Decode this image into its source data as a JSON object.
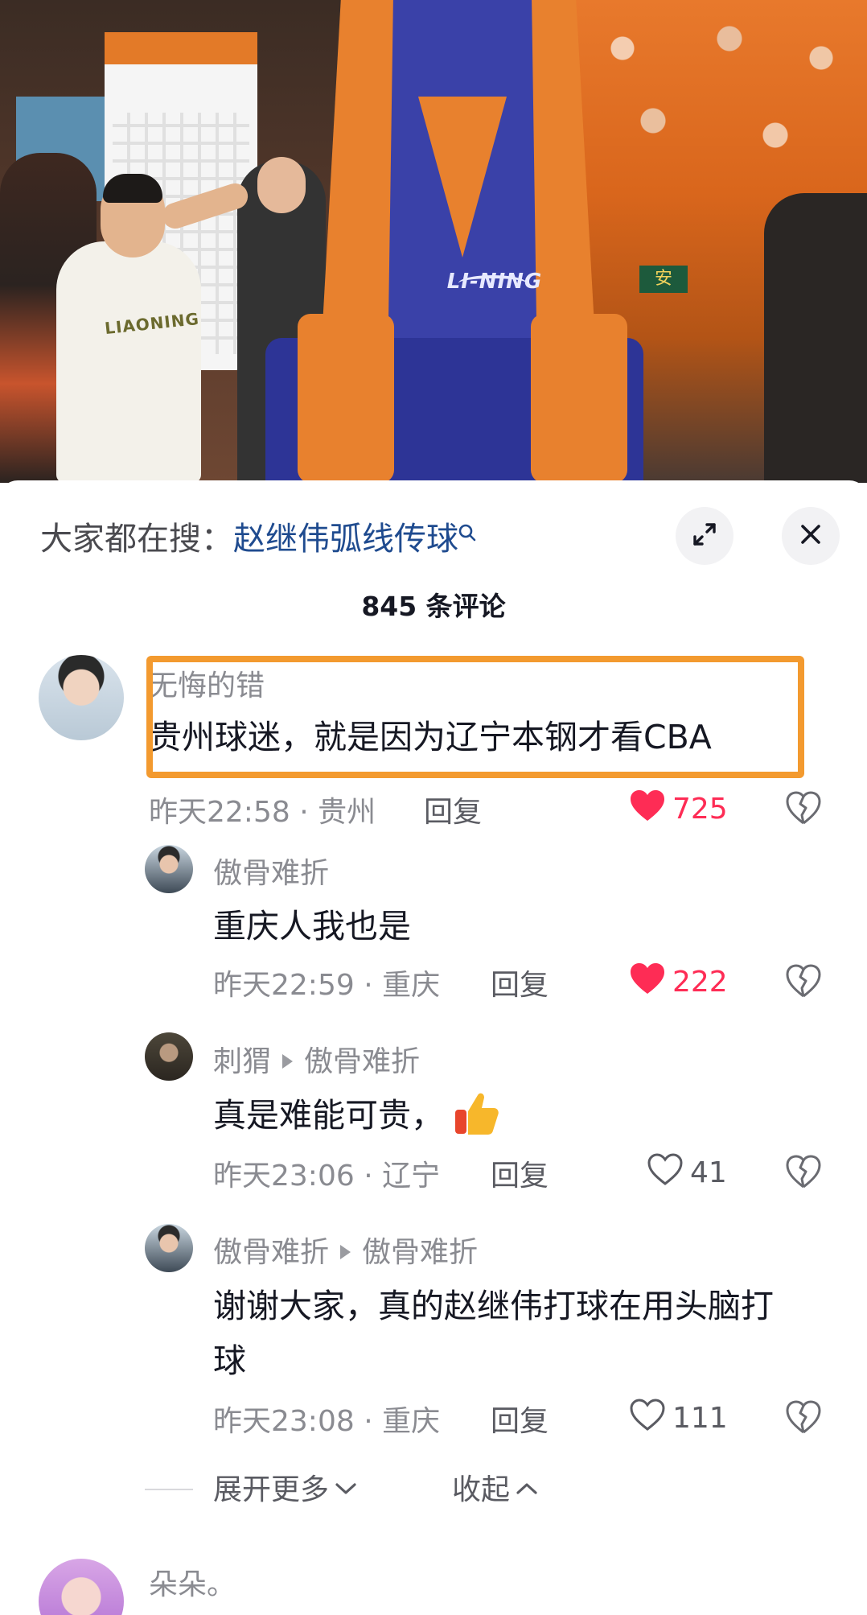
{
  "video": {
    "brand_text": "LI-NING",
    "sign_text": "安",
    "jersey_text": "LIAONING"
  },
  "search": {
    "prefix": "大家都在搜：",
    "term": "赵继伟弧线传球"
  },
  "comments_count_title": "845 条评论",
  "comments": [
    {
      "username": "无悔的错",
      "text": "贵州球迷，就是因为辽宁本钢才看CBA",
      "time_location": "昨天22:58 · 贵州",
      "reply_label": "回复",
      "likes": "725",
      "liked": true
    },
    {
      "username": "傲骨难折",
      "text": "重庆人我也是",
      "time_location": "昨天22:59 · 重庆",
      "reply_label": "回复",
      "likes": "222",
      "liked": true
    },
    {
      "username": "刺猬",
      "reply_to": "傲骨难折",
      "text": "真是难能可贵，",
      "time_location": "昨天23:06 · 辽宁",
      "reply_label": "回复",
      "likes": "41",
      "liked": false
    },
    {
      "username": "傲骨难折",
      "reply_to": "傲骨难折",
      "text_line1": "谢谢大家，真的赵继伟打球在用头脑打",
      "text_line2": "球",
      "time_location": "昨天23:08 · 重庆",
      "reply_label": "回复",
      "likes": "111",
      "liked": false
    }
  ],
  "expand_more_label": "展开更多",
  "collapse_label": "收起",
  "next_comment": {
    "username": "朵朵。"
  },
  "colors": {
    "like_red": "#fe2c55",
    "highlight_orange": "#f39a2f",
    "search_term_blue": "#1f4b8f"
  }
}
